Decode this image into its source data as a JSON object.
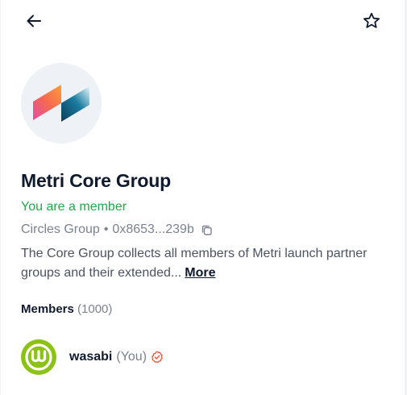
{
  "group": {
    "name": "Metri Core Group",
    "membership_status": "You are a member",
    "type": "Circles Group",
    "separator": "•",
    "address_short": "0x8653...239b",
    "description": "The Core Group collects all members of Metri launch partner groups and their extended...",
    "more_label": "More"
  },
  "members": {
    "heading": "Members",
    "count": "(1000)",
    "list": [
      {
        "name": "wasabi",
        "suffix": "(You)",
        "verified": true
      }
    ]
  },
  "icons": {
    "back": "arrow-left-icon",
    "favorite": "star-outline-icon",
    "copy": "copy-icon",
    "verified": "verified-badge-icon"
  },
  "colors": {
    "member_status": "#22a84a",
    "verified_badge": "#e8563a",
    "avatar_bg": "#8cc215",
    "logo_bg": "#eef1f5"
  }
}
